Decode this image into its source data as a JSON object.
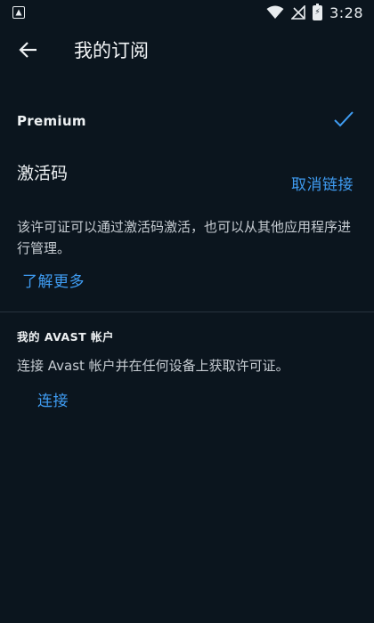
{
  "status_bar": {
    "time": "3:28",
    "notification_icon": "app-notification-icon",
    "wifi_icon": "wifi-icon",
    "signal_icon": "no-signal-icon",
    "battery_icon": "battery-charging-icon"
  },
  "header": {
    "back_icon": "arrow-left-icon",
    "title": "我的订阅"
  },
  "subscription": {
    "plan_name": "Premium",
    "active_icon": "check-icon"
  },
  "activation": {
    "title": "激活码",
    "unlink_label": "取消链接",
    "description": "该许可证可以通过激活码激活，也可以从其他应用程序进行管理。",
    "learn_more_label": "了解更多"
  },
  "account": {
    "heading": "我的 AVAST 帐户",
    "description": "连接 Avast 帐户并在任何设备上获取许可证。",
    "connect_label": "连接"
  },
  "colors": {
    "background": "#0b151e",
    "accent": "#3f9cf2",
    "text_primary": "#eef1f3",
    "text_secondary": "#c6ccd2",
    "divider": "#27333d"
  }
}
